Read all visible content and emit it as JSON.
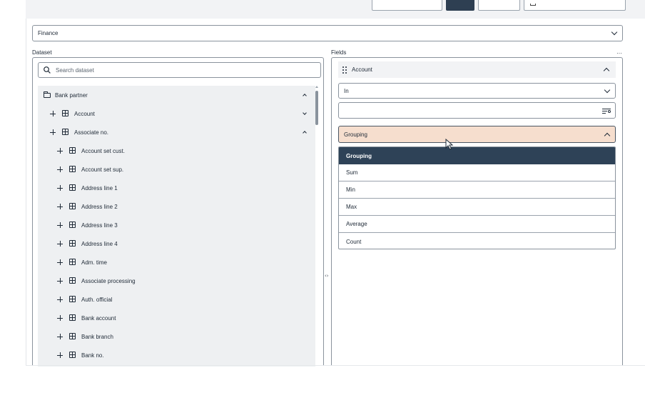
{
  "module_select": {
    "value": "Finance"
  },
  "dataset": {
    "label": "Dataset",
    "search_placeholder": "Search dataset",
    "tree": {
      "root": {
        "label": "Bank partner",
        "expanded": true
      },
      "groups": [
        {
          "label": "Account",
          "expanded": false
        },
        {
          "label": "Associate no.",
          "expanded": true
        }
      ],
      "fields": [
        "Account set cust.",
        "Account set sup.",
        "Address line 1",
        "Address line 2",
        "Address line 3",
        "Address line 4",
        "Adm. time",
        "Associate processing",
        "Auth. official",
        "Bank account",
        "Bank branch",
        "Bank no."
      ]
    }
  },
  "fields": {
    "label": "Fields",
    "more_label": "···",
    "field_card": {
      "name": "Account",
      "operator": "In",
      "value": "",
      "aggregation": "Grouping"
    },
    "aggregation_options": [
      "Grouping",
      "Sum",
      "Min",
      "Max",
      "Average",
      "Count"
    ],
    "selected_option": "Grouping"
  },
  "colors": {
    "selected_option_bg": "#2e4257",
    "highlight_select_bg": "#f6dece",
    "tree_bg": "#eef0f2"
  },
  "icons": [
    "search-icon",
    "folder-icon",
    "plus-icon",
    "table-icon",
    "chevron-down-icon",
    "chevron-up-icon",
    "drag-handle-icon",
    "filter-list-icon",
    "resize-splitter-icon",
    "mouse-cursor-icon"
  ]
}
